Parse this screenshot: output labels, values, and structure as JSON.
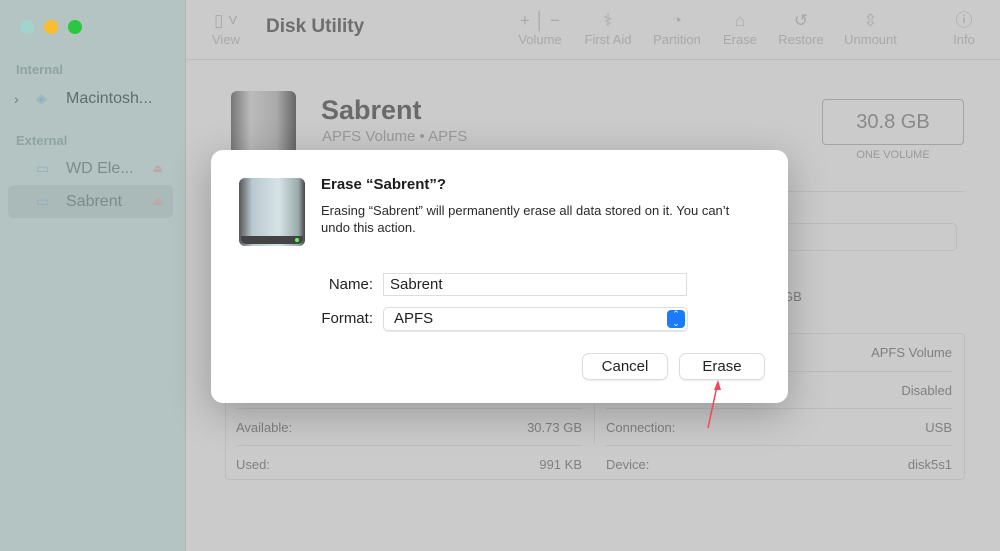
{
  "window": {
    "title": "Disk Utility"
  },
  "sidebar": {
    "sections": [
      {
        "label": "Internal",
        "items": [
          {
            "label": "Macintosh..."
          }
        ]
      },
      {
        "label": "External",
        "items": [
          {
            "label": "WD Ele..."
          },
          {
            "label": "Sabrent",
            "selected": true
          }
        ]
      }
    ]
  },
  "toolbar": {
    "view": "View",
    "volume": "Volume",
    "first_aid": "First Aid",
    "partition": "Partition",
    "erase": "Erase",
    "restore": "Restore",
    "unmount": "Unmount",
    "info": "Info"
  },
  "volume": {
    "name": "Sabrent",
    "subtitle": "APFS Volume • APFS",
    "size": "30.8 GB",
    "size_label": "ONE VOLUME",
    "partial_capacity": "GB"
  },
  "details": {
    "left": [
      {
        "label": "Available:",
        "value": "30.73 GB"
      },
      {
        "label": "Used:",
        "value": "991 KB"
      }
    ],
    "right": [
      {
        "label": "",
        "value": "APFS Volume"
      },
      {
        "label": "",
        "value": "Disabled"
      },
      {
        "label": "Connection:",
        "value": "USB"
      },
      {
        "label": "Device:",
        "value": "disk5s1"
      }
    ]
  },
  "dialog": {
    "title": "Erase “Sabrent”?",
    "message": "Erasing “Sabrent” will permanently erase all data stored on it. You can’t undo this action.",
    "name_label": "Name:",
    "name_value": "Sabrent",
    "format_label": "Format:",
    "format_value": "APFS",
    "cancel": "Cancel",
    "erase": "Erase"
  },
  "colors": {
    "accent": "#1a7bff",
    "annotation": "#f0475a"
  }
}
